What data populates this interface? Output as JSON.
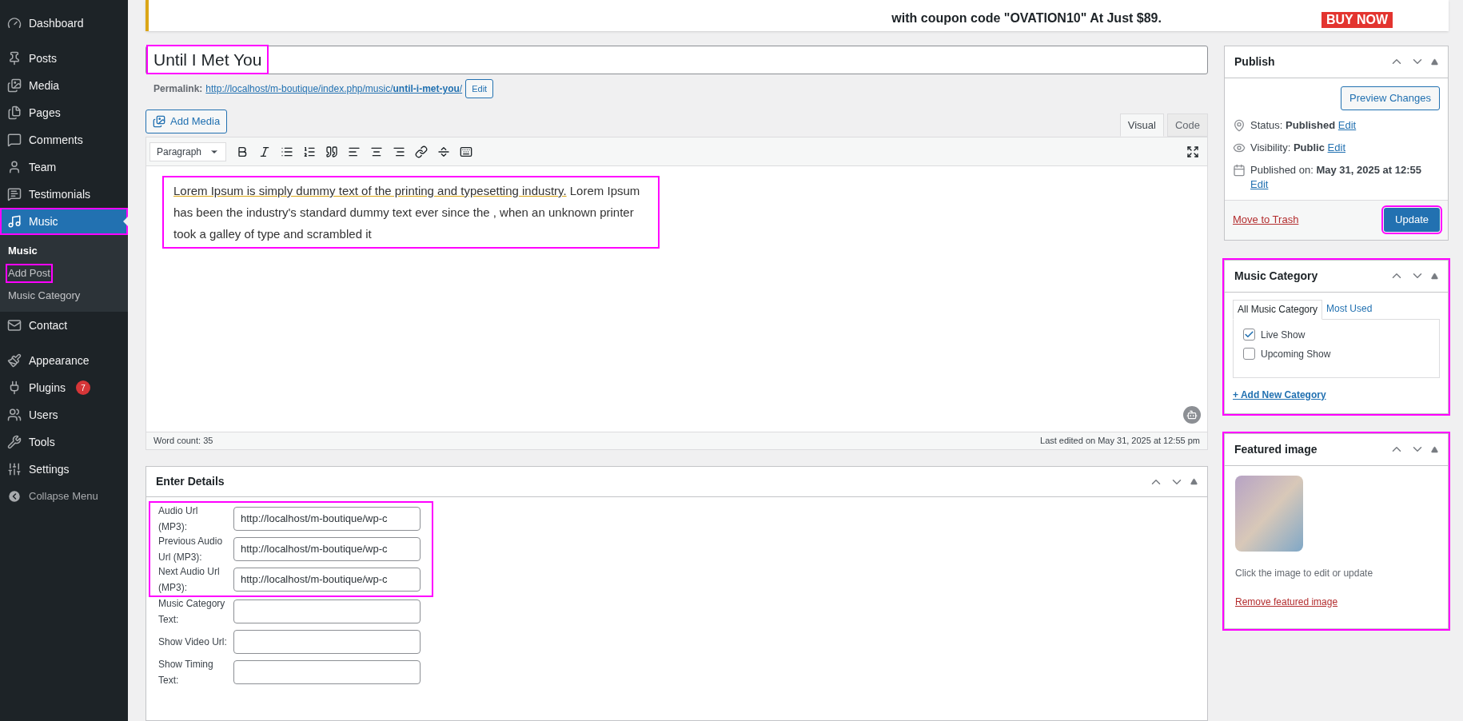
{
  "sidebar": {
    "items": [
      {
        "label": "Dashboard",
        "selected": false
      },
      {
        "label": "Posts",
        "selected": false
      },
      {
        "label": "Media",
        "selected": false
      },
      {
        "label": "Pages",
        "selected": false
      },
      {
        "label": "Comments",
        "selected": false
      },
      {
        "label": "Team",
        "selected": false
      },
      {
        "label": "Testimonials",
        "selected": false
      },
      {
        "label": "Music",
        "selected": true,
        "highlighted": true,
        "children": [
          {
            "label": "Music",
            "selected": true,
            "highlighted": false
          },
          {
            "label": "Add Post",
            "selected": false,
            "highlighted": true
          },
          {
            "label": "Music Category",
            "selected": false,
            "highlighted": false
          }
        ]
      },
      {
        "label": "Contact",
        "selected": false
      },
      {
        "label": "Appearance",
        "selected": false
      },
      {
        "label": "Plugins",
        "selected": false,
        "badge": "7"
      },
      {
        "label": "Users",
        "selected": false
      },
      {
        "label": "Tools",
        "selected": false
      },
      {
        "label": "Settings",
        "selected": false
      }
    ],
    "collapse": "Collapse Menu"
  },
  "banner": {
    "text": "with coupon code \"OVATION10\" At Just $89.",
    "button": "BUY NOW"
  },
  "title": {
    "value": "Until I Met You",
    "highlighted": true
  },
  "permalink": {
    "label": "Permalink:",
    "url_start": "http://localhost/m-boutique/index.php/music/",
    "url_slug": "until-i-met-you",
    "url_end": "/",
    "edit": "Edit"
  },
  "add_media": "Add Media",
  "editor_tabs": [
    {
      "label": "Visual",
      "selected": true
    },
    {
      "label": "Code",
      "selected": false
    }
  ],
  "format_select": "Paragraph",
  "content": {
    "underlined": "Lorem Ipsum is simply dummy text of the printing and typesetting industry.",
    "rest": " Lorem Ipsum has been the industry's standard dummy text ever since the , when an unknown printer took a galley of type and scrambled it",
    "highlighted": true
  },
  "word_count": "Word count: 35",
  "last_edited": "Last edited on May 31, 2025 at 12:55 pm",
  "details": {
    "title": "Enter Details",
    "groups": [
      {
        "highlighted": true,
        "fields": [
          {
            "label": "Audio Url (MP3):",
            "value": "http://localhost/m-boutique/wp-c"
          },
          {
            "label": "Previous Audio Url (MP3):",
            "value": "http://localhost/m-boutique/wp-c"
          },
          {
            "label": "Next Audio Url (MP3):",
            "value": "http://localhost/m-boutique/wp-c"
          }
        ]
      },
      {
        "highlighted": false,
        "fields": [
          {
            "label": "Music Category Text:"
          },
          {
            "label": "Show Video Url:"
          },
          {
            "label": "Show Timing Text:"
          }
        ]
      }
    ]
  },
  "publish": {
    "title": "Publish",
    "preview": "Preview Changes",
    "rows": [
      {
        "label": "Status: ",
        "value": "Published",
        "edit": "Edit"
      },
      {
        "label": "Visibility: ",
        "value": "Public",
        "edit": "Edit"
      },
      {
        "label": "Published on: ",
        "value": "May 31, 2025 at 12:55",
        "edit": "Edit"
      }
    ],
    "trash": "Move to Trash",
    "update": {
      "label": "Update",
      "highlighted": true
    }
  },
  "music_category": {
    "title": "Music Category",
    "highlighted": true,
    "tabs": [
      {
        "label": "All Music Category",
        "selected": true
      },
      {
        "label": "Most Used",
        "selected": false
      }
    ],
    "items": [
      {
        "label": "Live Show",
        "checked": true
      },
      {
        "label": "Upcoming Show",
        "checked": false
      }
    ],
    "add": "+ Add New Category"
  },
  "featured": {
    "title": "Featured image",
    "highlighted": true,
    "hint": "Click the image to edit or update",
    "remove": "Remove featured image"
  }
}
